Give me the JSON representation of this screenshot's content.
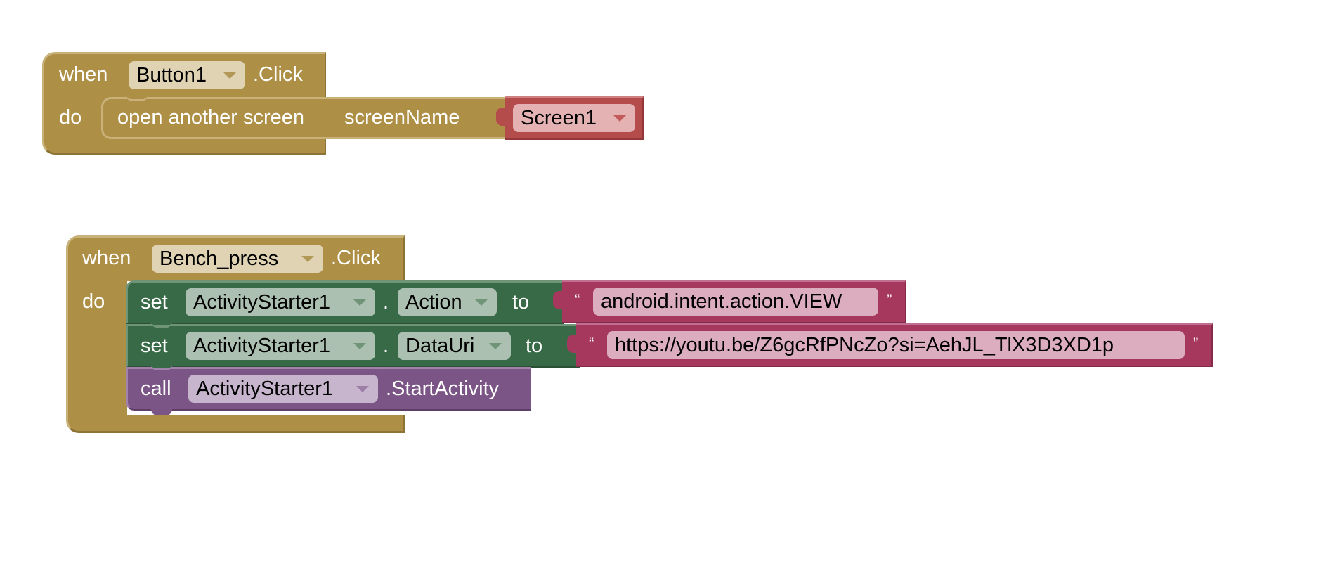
{
  "workspace": {
    "event_blocks": [
      {
        "keyword_when": "when",
        "component": "Button1",
        "event": ".Click",
        "keyword_do": "do",
        "statements": [
          {
            "type": "open_another_screen",
            "label": "open another screen",
            "param_label": "screenName",
            "value_block": {
              "type": "screen_name",
              "value": "Screen1"
            }
          }
        ]
      },
      {
        "keyword_when": "when",
        "component": "Bench_press",
        "event": ".Click",
        "keyword_do": "do",
        "statements": [
          {
            "type": "set_property",
            "keyword": "set",
            "component": "ActivityStarter1",
            "dot": ".",
            "property": "Action",
            "keyword_to": "to",
            "value_block": {
              "type": "text",
              "open_quote": "“",
              "value": "android.intent.action.VIEW",
              "close_quote": "”"
            }
          },
          {
            "type": "set_property",
            "keyword": "set",
            "component": "ActivityStarter1",
            "dot": ".",
            "property": "DataUri",
            "keyword_to": "to",
            "value_block": {
              "type": "text",
              "open_quote": "“",
              "value": "https://youtu.be/Z6gcRfPNcZo?si=AehJL_TlX3D3XD1p",
              "close_quote": "”"
            }
          },
          {
            "type": "call_method",
            "keyword": "call",
            "component": "ActivityStarter1",
            "method": ".StartActivity"
          }
        ]
      }
    ],
    "colors": {
      "event_block": "#ad8f45",
      "set_block": "#386a48",
      "call_block": "#7a5585",
      "text_block": "#a6385d",
      "screen_block": "#b44c4c"
    }
  }
}
